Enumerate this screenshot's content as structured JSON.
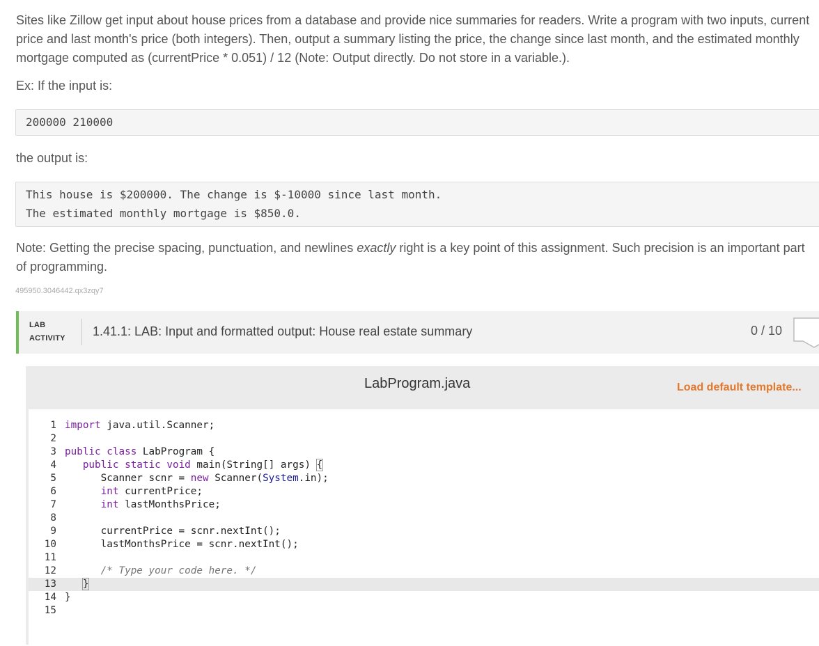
{
  "description": {
    "paragraph1": "Sites like Zillow get input about house prices from a database and provide nice summaries for readers. Write a program with two inputs, current price and last month's price (both integers). Then, output a summary listing the price, the change since last month, and the estimated monthly mortgage computed as (currentPrice * 0.051) / 12 (Note: Output directly. Do not store in a variable.).",
    "example_label": "Ex: If the input is:",
    "example_input": "200000 210000",
    "output_label": "the output is:",
    "example_output_line1": "This house is $200000. The change is $-10000 since last month.",
    "example_output_line2": "The estimated monthly mortgage is $850.0.",
    "note_prefix": "Note: Getting the precise spacing, punctuation, and newlines ",
    "note_emphasis": "exactly",
    "note_suffix": " right is a key point of this assignment. Such precision is an important part of programming.",
    "tag": "495950.3046442.qx3zqy7"
  },
  "lab": {
    "label_line1": "LAB",
    "label_line2": "ACTIVITY",
    "title": "1.41.1: LAB: Input and formatted output: House real estate summary",
    "score": "0 / 10"
  },
  "editor": {
    "filename": "LabProgram.java",
    "load_template": "Load default template...",
    "line_numbers": [
      "1",
      "2",
      "3",
      "4",
      "5",
      "6",
      "7",
      "8",
      "9",
      "10",
      "11",
      "12",
      "13",
      "14",
      "15"
    ],
    "active_line": 13,
    "code_lines": [
      "import java.util.Scanner;",
      "",
      "public class LabProgram {",
      "   public static void main(String[] args) {",
      "      Scanner scnr = new Scanner(System.in);",
      "      int currentPrice;",
      "      int lastMonthsPrice;",
      "",
      "      currentPrice = scnr.nextInt();",
      "      lastMonthsPrice = scnr.nextInt();",
      "",
      "      /* Type your code here. */",
      "   }",
      "}",
      ""
    ]
  },
  "colors": {
    "accent_green": "#6fbe5a",
    "load_orange": "#e4772a"
  }
}
